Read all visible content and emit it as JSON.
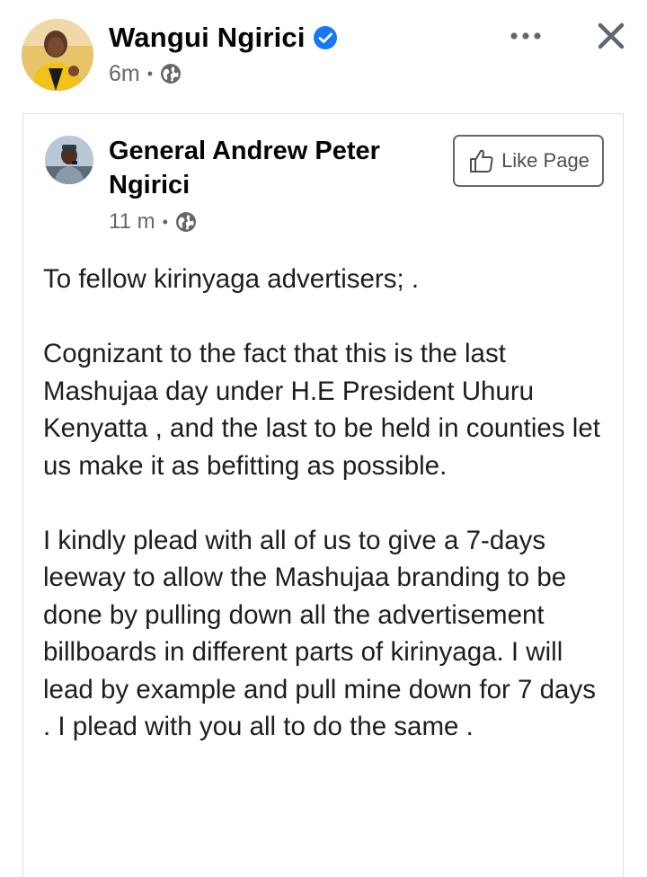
{
  "post": {
    "author_name": "Wangui Ngirici",
    "verified": true,
    "timestamp": "6m",
    "audience": "globe-icon",
    "actions": {
      "more": "more-icon",
      "close": "close-icon"
    }
  },
  "shared_post": {
    "page_name": "General Andrew Peter Ngirici",
    "timestamp": "11 m",
    "audience": "globe-icon",
    "like_page_label": "Like Page",
    "body": {
      "greeting": "To fellow kirinyaga advertisers; .",
      "paragraph_1": "Cognizant to the fact that this is the last Mashujaa day under H.E President Uhuru Kenyatta , and the last to be held in counties let us make it as befitting as possible.",
      "paragraph_2": "I kindly plead with all of us to give a 7-days leeway to allow the Mashujaa branding to be done by pulling down all the advertisement billboards  in different parts of kirinyaga. I will lead by example and pull mine down for 7 days . I plead with you all to do the same ."
    }
  },
  "colors": {
    "verified_blue": "#1877f2",
    "meta_gray": "#65676b",
    "text": "#1c1e21",
    "border": "#dddfe2"
  }
}
